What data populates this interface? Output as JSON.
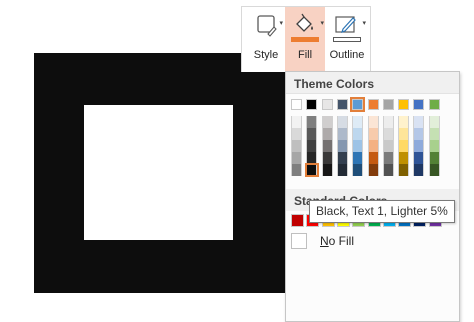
{
  "ribbon": {
    "style_label": "Style",
    "fill_label": "Fill",
    "outline_label": "Outline"
  },
  "dropdown": {
    "theme_header": "Theme Colors",
    "standard_header": "Standard Colors",
    "no_fill_prefix": "N",
    "no_fill_rest": "o Fill",
    "theme_colors": [
      "#ffffff",
      "#000000",
      "#e7e6e6",
      "#44546a",
      "#5b9bd5",
      "#ed7d31",
      "#a5a5a5",
      "#ffc000",
      "#4472c4",
      "#70ad47"
    ],
    "theme_shades": [
      [
        "#f2f2f2",
        "#d9d9d9",
        "#bfbfbf",
        "#a6a6a6",
        "#7f7f7f"
      ],
      [
        "#7f7f7f",
        "#595959",
        "#404040",
        "#262626",
        "#0d0d0d"
      ],
      [
        "#d0cece",
        "#aeaaaa",
        "#757171",
        "#3a3838",
        "#171616"
      ],
      [
        "#d6dce4",
        "#adb9ca",
        "#8497b0",
        "#333f4f",
        "#222a35"
      ],
      [
        "#deebf6",
        "#bdd7ee",
        "#9dc3e6",
        "#2e75b5",
        "#1f4e79"
      ],
      [
        "#fbe5d5",
        "#f7cbac",
        "#f4b183",
        "#c55a11",
        "#833c0b"
      ],
      [
        "#ededed",
        "#dbdbdb",
        "#c9c9c9",
        "#7b7b7b",
        "#525252"
      ],
      [
        "#fff2cc",
        "#fee599",
        "#ffd965",
        "#bf9000",
        "#7f6000"
      ],
      [
        "#d9e2f3",
        "#b4c7e7",
        "#8eaadb",
        "#2f5496",
        "#1f3864"
      ],
      [
        "#e2efd9",
        "#c5e0b3",
        "#a8d08d",
        "#538135",
        "#375623"
      ]
    ],
    "standard_colors": [
      "#c00000",
      "#ff0000",
      "#ffc000",
      "#ffff00",
      "#92d050",
      "#00b050",
      "#00b0f0",
      "#0070c0",
      "#002060",
      "#7030a0"
    ],
    "selected_theme_index": 4,
    "selected_shade": {
      "column": 1,
      "row": 4
    }
  },
  "tooltip": {
    "text": "Black, Text 1, Lighter 5%"
  }
}
